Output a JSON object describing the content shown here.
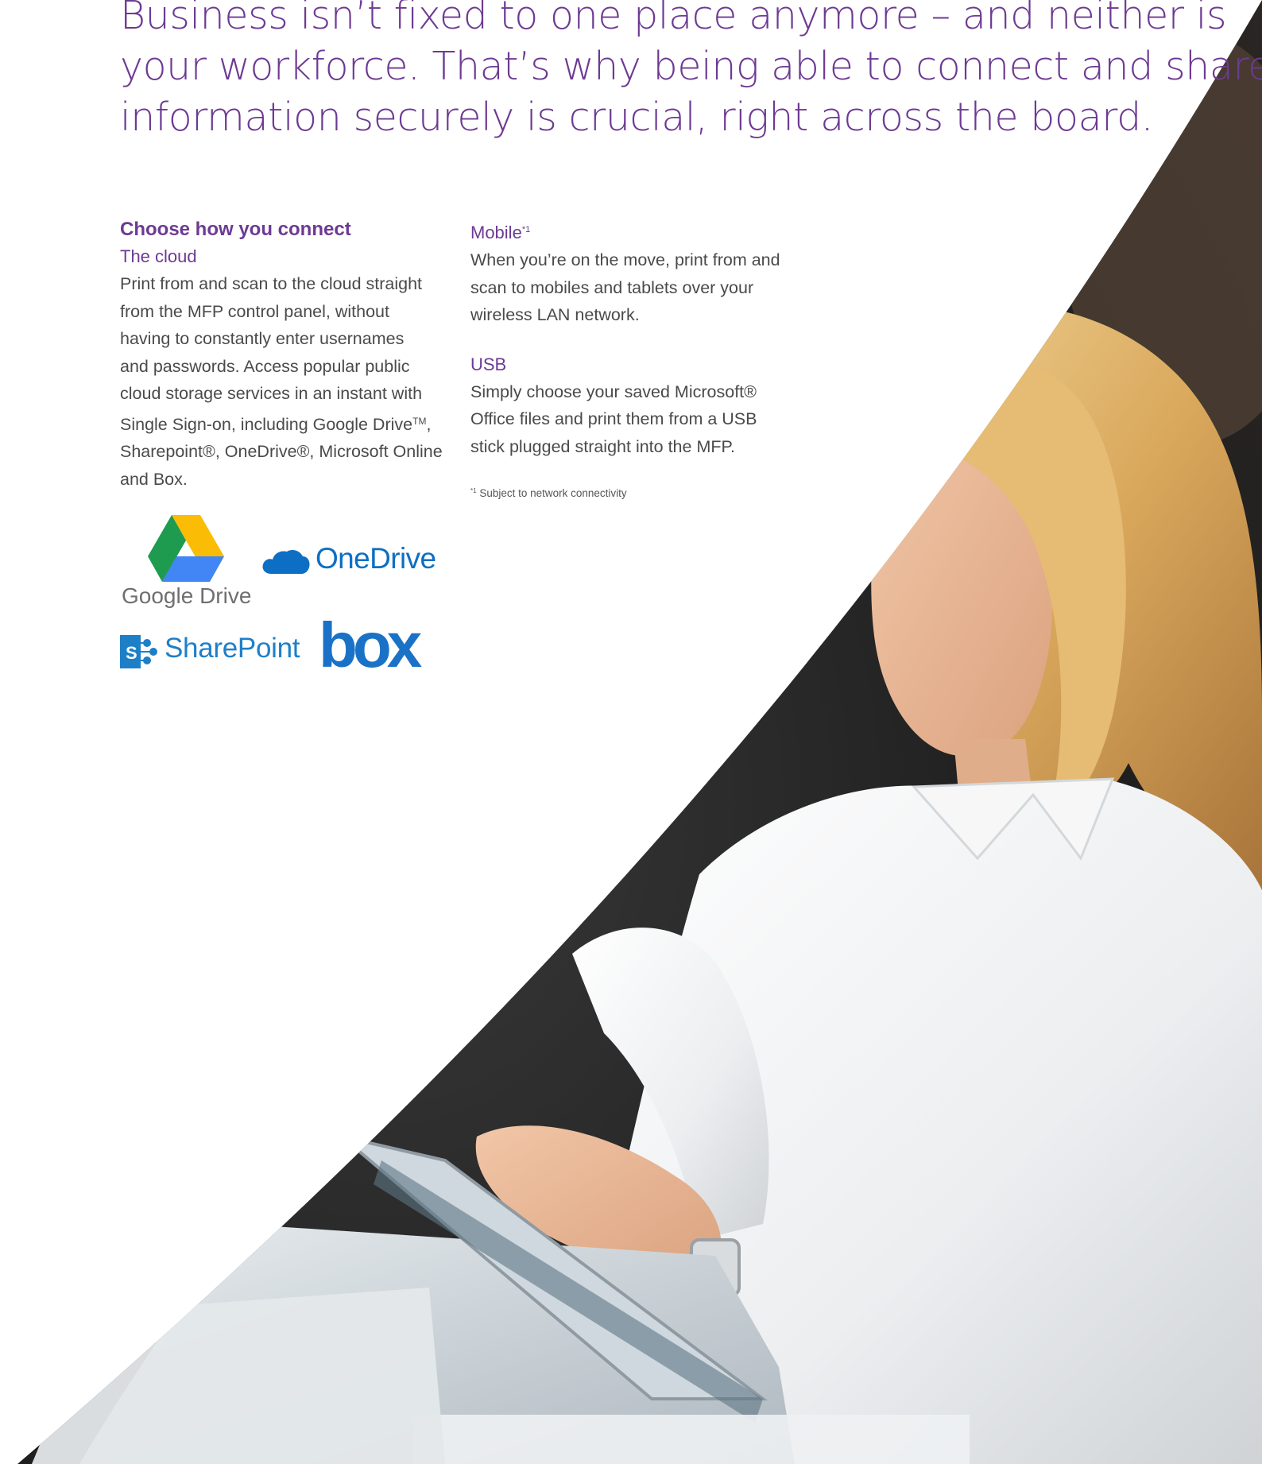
{
  "headline": {
    "line1": "Business isn’t fixed to one place anymore – and neither is",
    "line2": "your workforce. That’s why being able to connect and share",
    "line3": "information securely is crucial, right across the board."
  },
  "left_column": {
    "heading": "Choose how you connect",
    "cloud_title": "The cloud",
    "cloud_lines": [
      "Print from and scan to the cloud straight",
      "from the MFP control panel, without",
      "having to constantly enter usernames",
      "and passwords. Access popular public",
      "cloud storage services in an instant with",
      "Single Sign-on, including Google Drive",
      "Sharepoint®, OneDrive®, Microsoft Online",
      "and Box."
    ],
    "tm_mark": "TM",
    "tm_comma": ","
  },
  "right_column": {
    "mobile_title": "Mobile",
    "mobile_sup": "*1",
    "mobile_lines": [
      "When you’re on the move, print from and",
      "scan to mobiles and tablets over your",
      "wireless LAN network."
    ],
    "usb_title": "USB",
    "usb_lines": [
      "Simply choose your saved Microsoft®",
      "Office files and print them from a USB",
      "stick plugged straight into the MFP."
    ],
    "footnote_sup": "*1",
    "footnote_text": " Subject to network connectivity"
  },
  "logos": {
    "google_drive": "Google Drive",
    "onedrive": "OneDrive",
    "sharepoint": "SharePoint",
    "sharepoint_letter": "S",
    "box": "box"
  },
  "colors": {
    "brand_purple": "#6d3a93",
    "body_text": "#4a4a4a"
  }
}
